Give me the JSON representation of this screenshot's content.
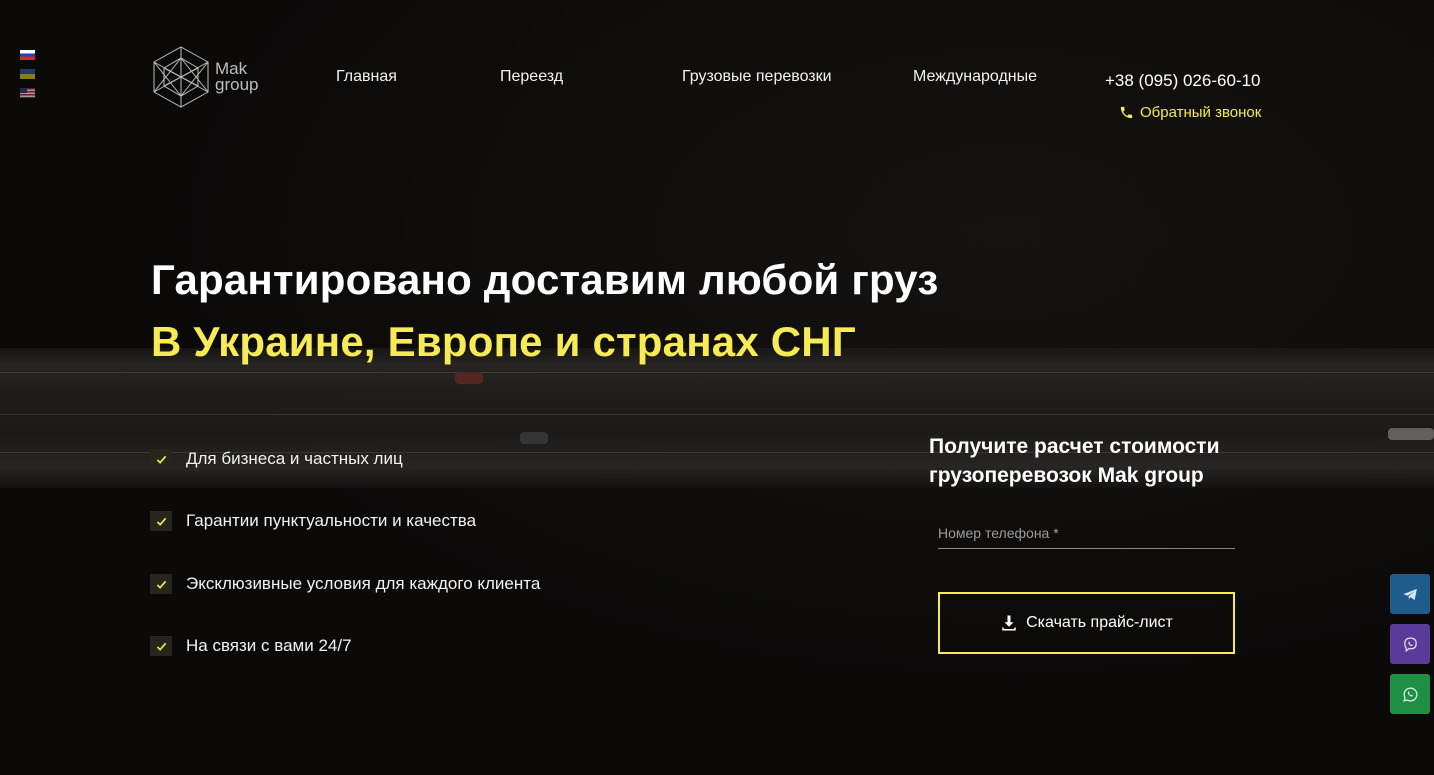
{
  "languages": [
    {
      "code": "ru",
      "name": "ru-flag-icon"
    },
    {
      "code": "ua",
      "name": "ua-flag-icon"
    },
    {
      "code": "en",
      "name": "us-flag-icon"
    }
  ],
  "logo": {
    "line1": "Mak",
    "line2": "group"
  },
  "nav": [
    {
      "label": "Главная"
    },
    {
      "label": "Переезд"
    },
    {
      "label": "Грузовые перевозки"
    },
    {
      "label": "Международные"
    }
  ],
  "contact": {
    "phone": "+38 (095) 026-60-10",
    "callback_label": "Обратный звонок"
  },
  "hero": {
    "title": "Гарантировано доставим любой груз",
    "subtitle": "В Украине, Европе и странах СНГ"
  },
  "features": [
    "Для бизнеса и частных лиц",
    "Гарантии пунктуальности и качества",
    "Эксклюзивные условия для каждого клиента",
    "На связи с вами 24/7"
  ],
  "form": {
    "title": "Получите расчет стоимости грузоперевозок Mak group",
    "phone_placeholder": "Номер телефона *",
    "button_label": "Скачать прайс-лист"
  },
  "social": [
    {
      "name": "telegram-icon",
      "color": "#1f5c8c"
    },
    {
      "name": "viber-icon",
      "color": "#5b3b9a"
    },
    {
      "name": "whatsapp-icon",
      "color": "#1e8f45"
    }
  ],
  "colors": {
    "accent": "#f6ea55",
    "background": "#0b0a09"
  }
}
